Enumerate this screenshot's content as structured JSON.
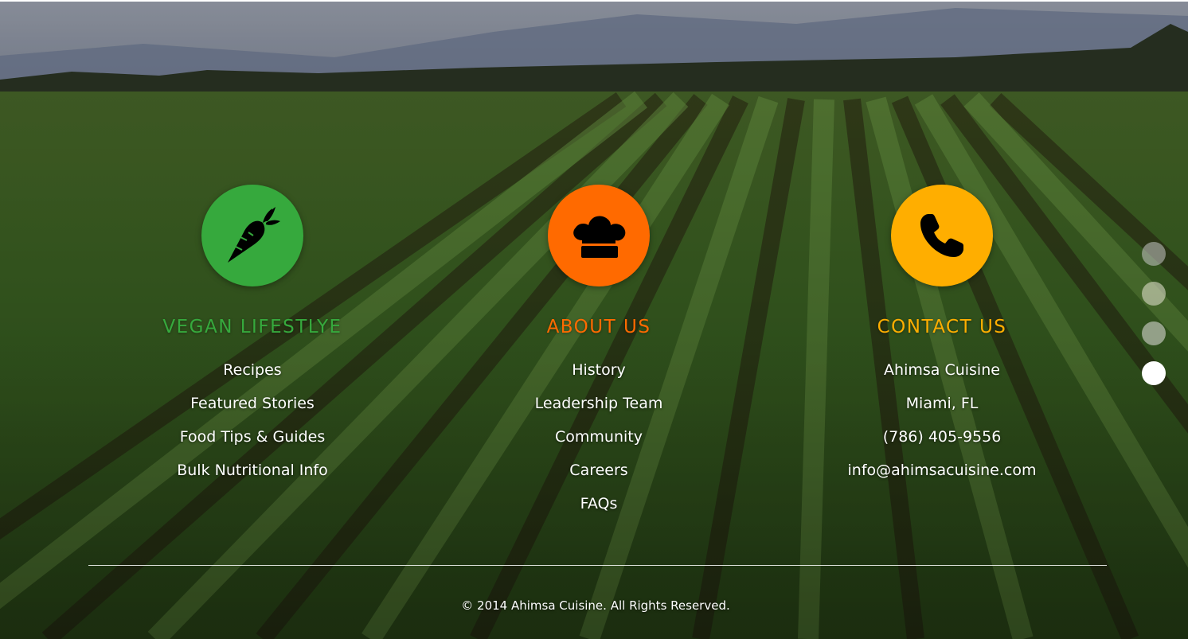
{
  "colors": {
    "vegan_accent": "#36a93d",
    "about_accent": "#ff6a00",
    "contact_accent": "#ffae00",
    "text": "#ffffff"
  },
  "columns": [
    {
      "icon": "carrot-icon",
      "heading": "VEGAN LIFESTLYE",
      "links": [
        "Recipes",
        "Featured Stories",
        "Food Tips & Guides",
        "Bulk Nutritional Info"
      ]
    },
    {
      "icon": "chef-hat-icon",
      "heading": "ABOUT US",
      "links": [
        "History",
        "Leadership Team",
        "Community",
        "Careers",
        "FAQs"
      ]
    },
    {
      "icon": "phone-icon",
      "heading": "CONTACT US",
      "links": [
        "Ahimsa Cuisine",
        "Miami, FL",
        "(786) 405-9556",
        "info@ahimsacuisine.com"
      ]
    }
  ],
  "slide_nav": {
    "count": 4,
    "active_index": 4
  },
  "footer": {
    "copyright": "© 2014 Ahimsa Cuisine. All Rights Reserved."
  }
}
